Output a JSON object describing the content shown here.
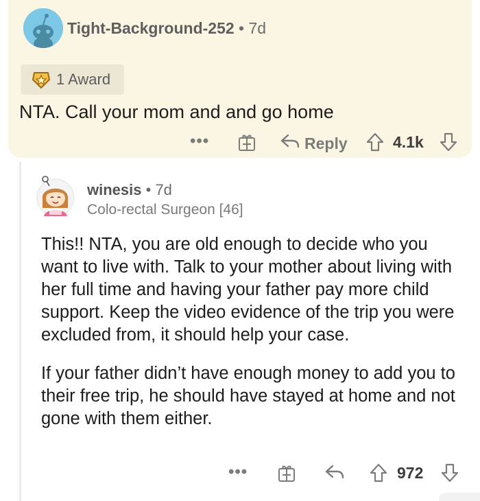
{
  "comment1": {
    "username": "Tight-Background-252",
    "separator": "•",
    "age": "7d",
    "award_label": "1 Award",
    "text": "NTA. Call your mom and and go home",
    "more": "•••",
    "reply_label": "Reply",
    "score": "4.1k",
    "icons": [
      "snoo-avatar-icon",
      "award-icon",
      "more-icon",
      "gift-award-icon",
      "reply-icon",
      "upvote-icon",
      "downvote-icon"
    ]
  },
  "comment2": {
    "username": "winesis",
    "separator": "•",
    "age": "7d",
    "flair": "Colo-rectal Surgeon [46]",
    "paragraph1": "This!! NTA, you are old enough to decide who you want to live with. Talk to your mother about living with her full time and having your father pay more child support. Keep the video evidence of the trip you were excluded from, it should help your case.",
    "paragraph2": "If your father didn’t have enough money to add you to their free trip, he should have stayed at home and not gone with them either.",
    "more": "•••",
    "score": "972",
    "icons": [
      "avatar-icon",
      "more-icon",
      "gift-award-icon",
      "reply-icon",
      "upvote-icon",
      "downvote-icon"
    ]
  },
  "colors": {
    "top_card_bg": "#fbf6e3",
    "award_bg": "#ece7d5",
    "avatar_bg": "#7cc8e6",
    "text": "#1c1c1c",
    "muted": "#7b7b7b"
  }
}
